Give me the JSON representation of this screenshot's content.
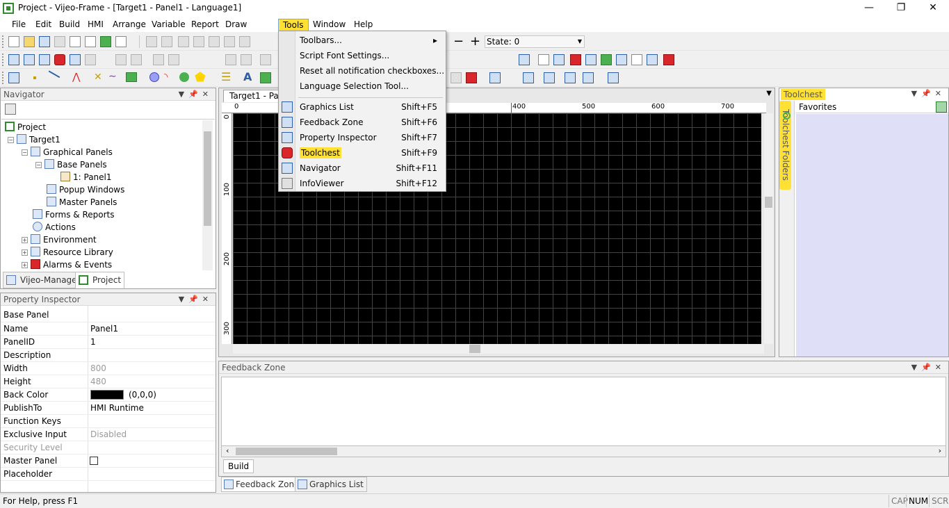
{
  "window": {
    "title": "Project - Vijeo-Frame - [Target1 - Panel1 - Language1]",
    "minimize": "—",
    "maximize": "❐",
    "close": "✕"
  },
  "menubar": {
    "items": [
      "File",
      "Edit",
      "Build",
      "HMI",
      "Arrange",
      "Variable",
      "Report",
      "Draw",
      "Tools",
      "Window",
      "Help"
    ],
    "active": "Tools"
  },
  "toolbar": {
    "state_label": "State: 0",
    "zoom_minus": "−",
    "zoom_plus": "+"
  },
  "tools_menu": {
    "items": [
      {
        "label": "Toolbars...",
        "shortcut": "",
        "submenu": "▸"
      },
      {
        "label": "Script Font Settings...",
        "shortcut": ""
      },
      {
        "label": "Reset all notification checkboxes...",
        "shortcut": ""
      },
      {
        "label": "Language Selection Tool...",
        "shortcut": ""
      },
      {
        "label": "Graphics List",
        "shortcut": "Shift+F5"
      },
      {
        "label": "Feedback Zone",
        "shortcut": "Shift+F6"
      },
      {
        "label": "Property Inspector",
        "shortcut": "Shift+F7"
      },
      {
        "label": "Toolchest",
        "shortcut": "Shift+F9"
      },
      {
        "label": "Navigator",
        "shortcut": "Shift+F11"
      },
      {
        "label": "InfoViewer",
        "shortcut": "Shift+F12"
      }
    ],
    "highlighted": "Toolchest"
  },
  "navigator": {
    "title": "Navigator",
    "tree": [
      {
        "label": "Project"
      },
      {
        "label": "Target1"
      },
      {
        "label": "Graphical Panels"
      },
      {
        "label": "Base Panels"
      },
      {
        "label": "1: Panel1"
      },
      {
        "label": "Popup Windows"
      },
      {
        "label": "Master Panels"
      },
      {
        "label": "Forms & Reports"
      },
      {
        "label": "Actions"
      },
      {
        "label": "Environment"
      },
      {
        "label": "Resource Library"
      },
      {
        "label": "Alarms & Events"
      }
    ],
    "tabs": [
      "Vijeo-Manager",
      "Project"
    ],
    "active_tab": "Project"
  },
  "property_inspector": {
    "title": "Property Inspector",
    "object": "Base Panel",
    "rows": [
      {
        "key": "Name",
        "value": "Panel1"
      },
      {
        "key": "PanelID",
        "value": "1"
      },
      {
        "key": "Description",
        "value": ""
      },
      {
        "key": "Width",
        "value": "800"
      },
      {
        "key": "Height",
        "value": "480"
      },
      {
        "key": "Back Color",
        "value": "(0,0,0)"
      },
      {
        "key": "PublishTo",
        "value": "HMI Runtime"
      },
      {
        "key": "Function Keys",
        "value": ""
      },
      {
        "key": "Exclusive Input",
        "value": "Disabled"
      },
      {
        "key": "Security Level",
        "value": ""
      },
      {
        "key": "Master Panel",
        "value": ""
      },
      {
        "key": "Placeholder",
        "value": ""
      }
    ]
  },
  "document": {
    "tab_label": "Target1 - Pa",
    "ruler_top": [
      "0",
      "400",
      "500",
      "600",
      "700"
    ],
    "ruler_left": [
      "0",
      "100",
      "200",
      "300"
    ]
  },
  "toolchest": {
    "title": "Toolchest",
    "folders_label": "Toolchest Folders",
    "favorites": "Favorites"
  },
  "feedback_zone": {
    "title": "Feedback Zone",
    "build_tab": "Build"
  },
  "bottom_tabs": [
    "Feedback Zone",
    "Graphics List"
  ],
  "statusbar": {
    "help": "For Help, press F1",
    "indicators": [
      "CAP",
      "NUM",
      "SCRL"
    ]
  },
  "colors": {
    "highlight": "#ffe135",
    "canvas": "#000000",
    "toolchest_bg": "#dfe0f7"
  }
}
